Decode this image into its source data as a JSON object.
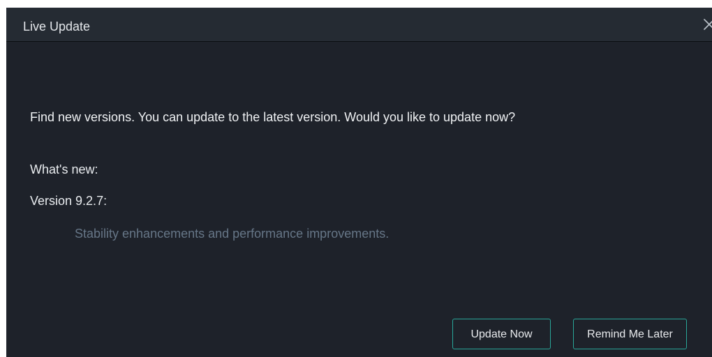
{
  "dialog": {
    "title": "Live Update",
    "close_icon": "close-icon"
  },
  "content": {
    "message": "Find new versions. You can update to the latest version. Would you like to update now?",
    "whats_new_label": "What's new:",
    "version_label": "Version 9.2.7:",
    "changelog": "Stability enhancements and performance improvements."
  },
  "actions": {
    "update_now_label": "Update Now",
    "remind_later_label": "Remind Me Later"
  },
  "colors": {
    "dialog_background": "#1e222a",
    "titlebar_background": "#252b33",
    "button_border_accent": "#29a89a",
    "muted_text": "#667687"
  }
}
